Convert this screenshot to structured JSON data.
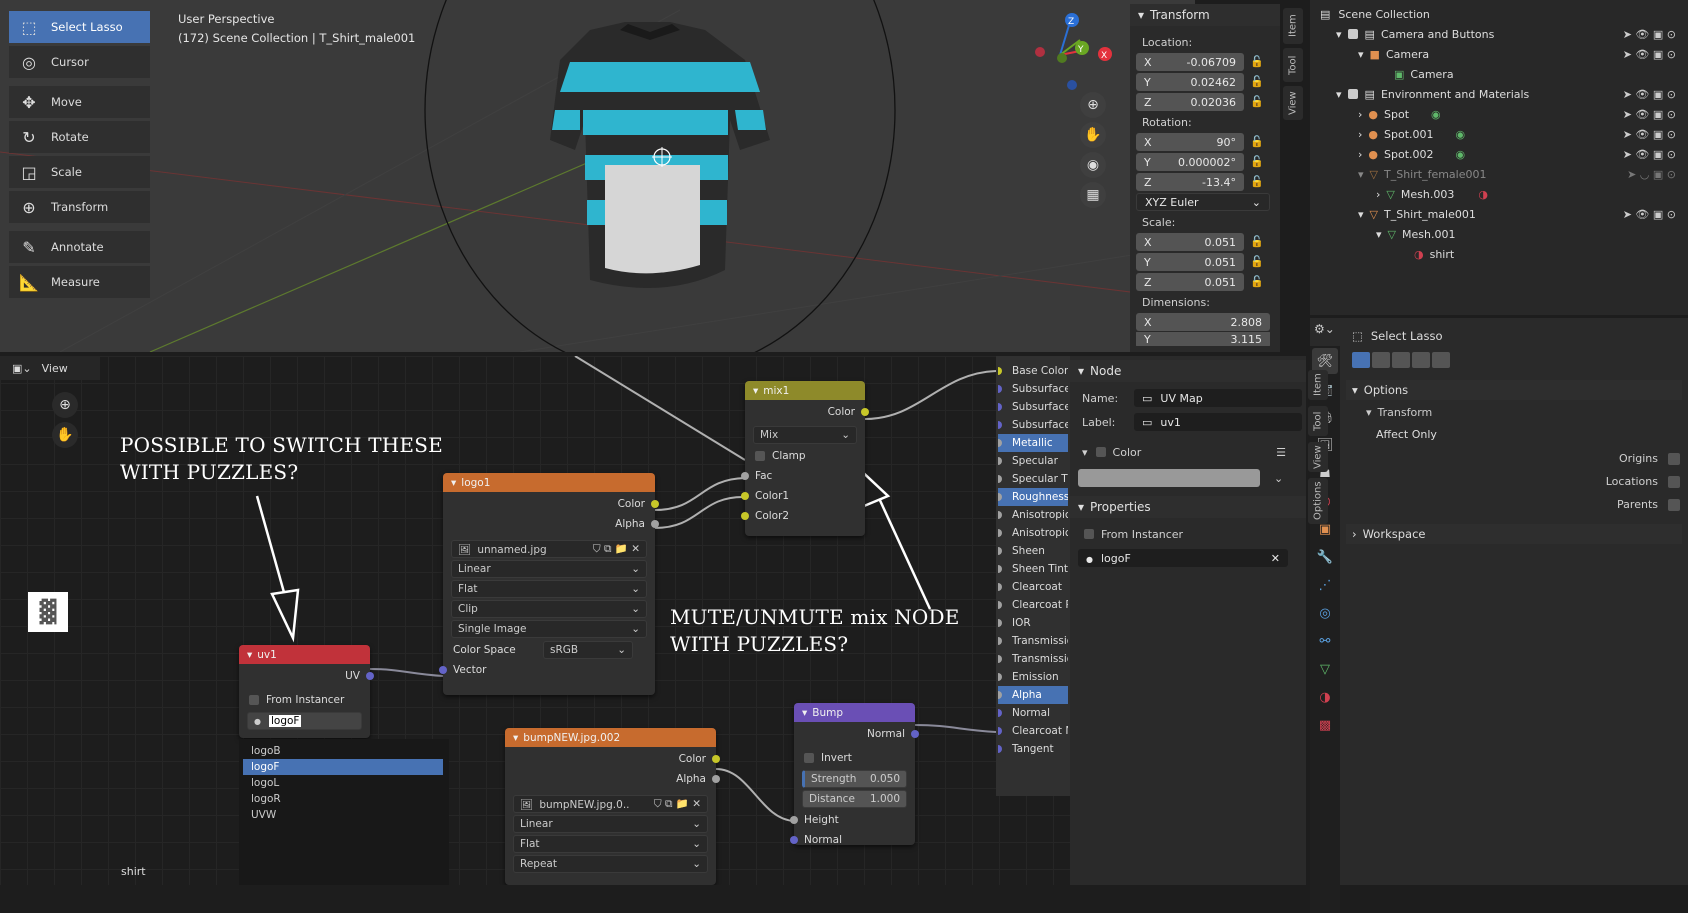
{
  "viewport": {
    "title": "User Perspective",
    "subtitle": "(172) Scene Collection | T_Shirt_male001",
    "tools": [
      "Select Lasso",
      "Cursor",
      "Move",
      "Rotate",
      "Scale",
      "Transform",
      "Annotate",
      "Measure"
    ],
    "gizmo_axes": [
      "Z",
      "Y",
      "X"
    ]
  },
  "npanel": {
    "header": "Transform",
    "location_label": "Location:",
    "location": [
      "-0.06709",
      "0.02462",
      "0.02036"
    ],
    "rotation_label": "Rotation:",
    "rotation": [
      "90°",
      "0.000002°",
      "-13.4°"
    ],
    "rotation_mode": "XYZ Euler",
    "scale_label": "Scale:",
    "scale": [
      "0.051",
      "0.051",
      "0.051"
    ],
    "dimensions_label": "Dimensions:",
    "dimensions": [
      "2.808",
      "3.115"
    ],
    "axis_labels": [
      "X",
      "Y",
      "Z"
    ],
    "tabs": [
      "Item",
      "Tool",
      "View"
    ]
  },
  "outliner": {
    "rows": [
      {
        "label": "Scene Collection"
      },
      {
        "label": "Camera and Buttons"
      },
      {
        "label": "Camera"
      },
      {
        "label": "Camera"
      },
      {
        "label": "Environment and Materials"
      },
      {
        "label": "Spot"
      },
      {
        "label": "Spot.001"
      },
      {
        "label": "Spot.002"
      },
      {
        "label": "T_Shirt_female001"
      },
      {
        "label": "Mesh.003"
      },
      {
        "label": "T_Shirt_male001"
      },
      {
        "label": "Mesh.001"
      },
      {
        "label": "shirt"
      }
    ]
  },
  "props": {
    "tool_name": "Select Lasso",
    "options": "Options",
    "transform": "Transform",
    "affect_only": "Affect Only",
    "origins": "Origins",
    "locations": "Locations",
    "parents": "Parents",
    "workspace": "Workspace"
  },
  "node_editor": {
    "view_menu": "View",
    "material_label": "shirt",
    "annotation1": [
      "POSSIBLE TO SWITCH THESE",
      "WITH PUZZLES?"
    ],
    "annotation2": [
      "MUTE/UNMUTE mix NODE",
      "WITH PUZZLES?"
    ],
    "uv_node": {
      "title": "uv1",
      "out": "UV",
      "from_instancer": "From Instancer",
      "value": "logoF"
    },
    "uv_list": [
      "logoB",
      "logoF",
      "logoL",
      "logoR",
      "UVW"
    ],
    "logo_node": {
      "title": "logo1",
      "out_color": "Color",
      "out_alpha": "Alpha",
      "image": "unnamed.jpg",
      "interp": "Linear",
      "proj": "Flat",
      "ext": "Clip",
      "source": "Single Image",
      "cs_label": "Color Space",
      "cs_value": "sRGB",
      "in_vector": "Vector"
    },
    "mix_node": {
      "title": "mix1",
      "out": "Color",
      "blend": "Mix",
      "clamp": "Clamp",
      "fac": "Fac",
      "c1": "Color1",
      "c2": "Color2"
    },
    "bump_img_node": {
      "title": "bumpNEW.jpg.002",
      "out_color": "Color",
      "out_alpha": "Alpha",
      "image": "bumpNEW.jpg.0..",
      "interp": "Linear",
      "proj": "Flat",
      "ext": "Repeat"
    },
    "bump_node": {
      "title": "Bump",
      "out": "Normal",
      "invert": "Invert",
      "strength_label": "Strength",
      "strength": "0.050",
      "distance_label": "Distance",
      "distance": "1.000",
      "height": "Height",
      "normal": "Normal"
    },
    "bsdf_inputs": [
      "Base Color",
      "Subsurface",
      "Subsurface",
      "Subsurface",
      "Metallic",
      "Specular",
      "Specular Ti",
      "Roughness",
      "Anisotropic",
      "Anisotropic",
      "Sheen",
      "Sheen Tint",
      "Clearcoat",
      "Clearcoat R",
      "IOR",
      "Transmissio",
      "Transmissio",
      "Emission",
      "Alpha",
      "Normal",
      "Clearcoat N",
      "Tangent"
    ],
    "bsdf_highlight": [
      4,
      7,
      18
    ]
  },
  "node_panel": {
    "header": "Node",
    "name_label": "Name:",
    "name_value": "UV Map",
    "label_label": "Label:",
    "label_value": "uv1",
    "color_label": "Color",
    "properties": "Properties",
    "from_instancer": "From Instancer",
    "attr_value": "logoF",
    "tabs": [
      "Item",
      "Tool",
      "View",
      "Options"
    ]
  },
  "colors": {
    "accent": "#4772b3",
    "uv_header": "#c1323a",
    "texture_header": "#c76b2e",
    "mix_header": "#8e8a2a",
    "bump_header": "#6a4fb5"
  }
}
